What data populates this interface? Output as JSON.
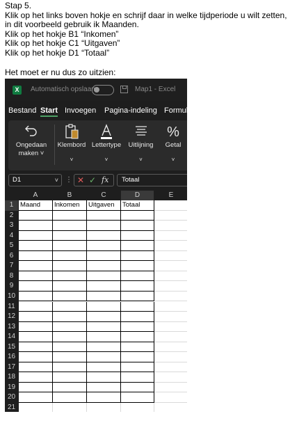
{
  "instructions": [
    "Stap 5.",
    "Klik op het links boven hokje en schrijf daar in welke tijdperiode u wilt zetten,",
    "in dit voorbeeld gebruik ik Maanden.",
    "Klik op het hokje B1 “Inkomen”",
    "Klik op het hokje C1 “Uitgaven”",
    "Klik op het hokje D1 “Totaal”",
    "Het moet er nu dus zo uitzien:"
  ],
  "excel": {
    "logo_letter": "X",
    "autosave_label": "Automatisch opslaan",
    "document_title": "Map1 - Excel",
    "tabs": [
      "Bestand",
      "Start",
      "Invoegen",
      "Pagina-indeling",
      "Formul"
    ],
    "active_tab": "Start",
    "ribbon": [
      {
        "label1": "Ongedaan",
        "label2": "maken",
        "icon": "undo-icon"
      },
      {
        "label1": "Klembord",
        "label2": "",
        "icon": "clipboard-icon"
      },
      {
        "label1": "Lettertype",
        "label2": "",
        "icon": "font-color-icon"
      },
      {
        "label1": "Uitlijning",
        "label2": "",
        "icon": "align-icon"
      },
      {
        "label1": "Getal",
        "label2": "",
        "icon": "percent-icon"
      }
    ],
    "name_box": "D1",
    "formula_value": "Totaal",
    "columns": [
      "A",
      "B",
      "C",
      "D",
      "E"
    ],
    "selected_column": "D",
    "selected_row": "1",
    "rows": [
      "1",
      "2",
      "3",
      "4",
      "5",
      "6",
      "7",
      "8",
      "9",
      "10",
      "11",
      "12",
      "13",
      "14",
      "15",
      "16",
      "17",
      "18",
      "19",
      "20",
      "21"
    ],
    "header_row": [
      "Maand",
      "Inkomen",
      "Uitgaven",
      "Totaal"
    ],
    "colors": {
      "accent": "#4ca064",
      "excel_green": "#107c41",
      "dark_bg": "#1e1e1e"
    }
  }
}
